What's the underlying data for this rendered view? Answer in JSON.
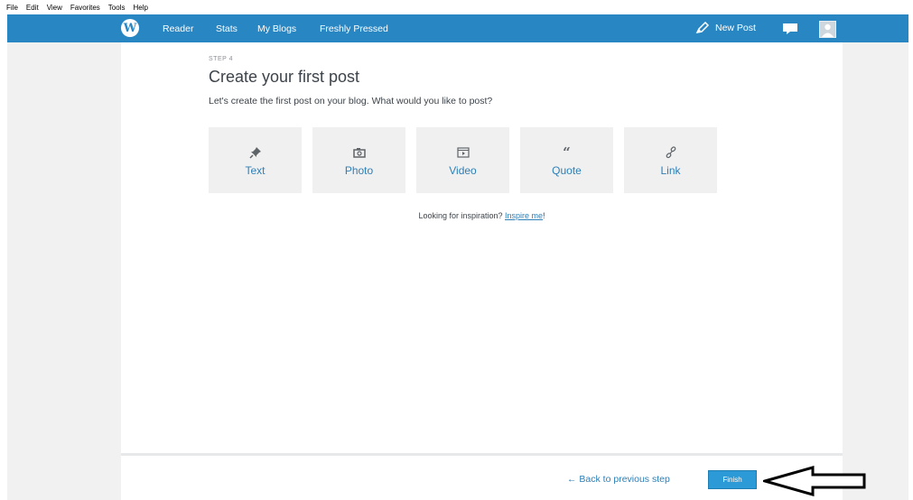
{
  "menubar": {
    "items": [
      "File",
      "Edit",
      "View",
      "Favorites",
      "Tools",
      "Help"
    ]
  },
  "adminbar": {
    "nav": [
      "Reader",
      "Stats",
      "My Blogs",
      "Freshly Pressed"
    ],
    "new_post": "New Post"
  },
  "content": {
    "step": "STEP 4",
    "title": "Create your first post",
    "subtitle": "Let's create the first post on your blog. What would you like to post?",
    "options": [
      {
        "label": "Text",
        "icon": "pin-icon"
      },
      {
        "label": "Photo",
        "icon": "camera-icon"
      },
      {
        "label": "Video",
        "icon": "video-icon"
      },
      {
        "label": "Quote",
        "icon": "quote-icon"
      },
      {
        "label": "Link",
        "icon": "link-icon"
      }
    ],
    "inspire_prefix": "Looking for inspiration? ",
    "inspire_link": "Inspire me",
    "inspire_suffix": "!"
  },
  "footer": {
    "back": "← Back to previous step",
    "finish": "Finish"
  },
  "colors": {
    "adminbar": "#2886c3",
    "link": "#2d7fb7",
    "button": "#2b9ad6"
  }
}
